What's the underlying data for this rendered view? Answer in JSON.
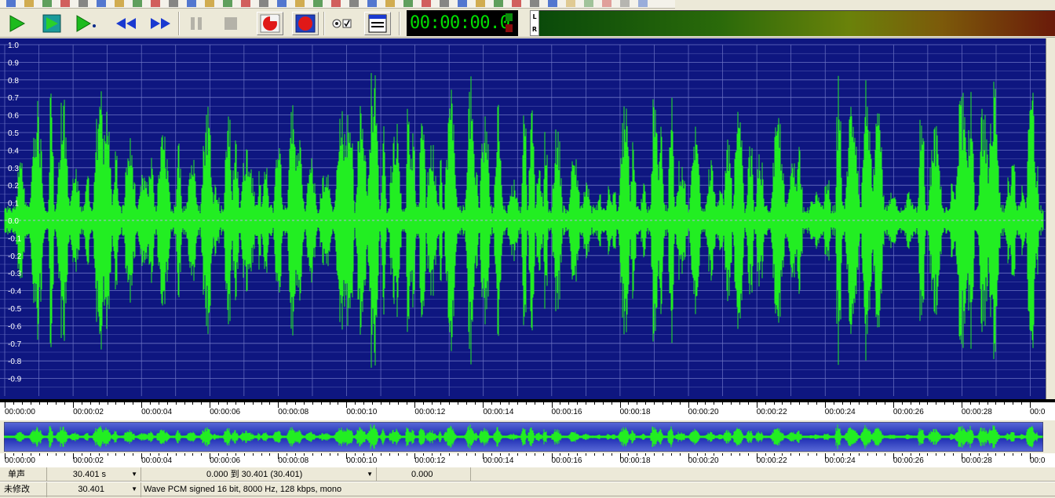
{
  "transport": {
    "buttons": [
      {
        "name": "play-button",
        "icon": "play-icon"
      },
      {
        "name": "play-selection-button",
        "icon": "play-to-end-icon"
      },
      {
        "name": "play-from-cursor-button",
        "icon": "play-cursor-icon"
      },
      {
        "name": "rewind-button",
        "icon": "rewind-icon"
      },
      {
        "name": "fast-forward-button",
        "icon": "fast-forward-icon"
      },
      {
        "name": "pause-button",
        "icon": "pause-icon"
      },
      {
        "name": "stop-button",
        "icon": "stop-icon"
      },
      {
        "name": "record-button",
        "icon": "record-icon"
      },
      {
        "name": "record-new-button",
        "icon": "record-new-icon"
      },
      {
        "name": "monitor-options-button",
        "icon": "radio-check-icon"
      },
      {
        "name": "view-window-button",
        "icon": "window-icon"
      }
    ],
    "time_display": "00:00:00.0",
    "meter_channels": [
      "L",
      "R"
    ]
  },
  "waveform": {
    "y_ticks": [
      "1.0",
      "0.9",
      "0.8",
      "0.7",
      "0.6",
      "0.5",
      "0.4",
      "0.3",
      "0.2",
      "0.1",
      "0.0",
      "-0.1",
      "-0.2",
      "-0.3",
      "-0.4",
      "-0.5",
      "-0.6",
      "-0.7",
      "-0.8",
      "-0.9"
    ],
    "duration_seconds": 30.401,
    "colors": {
      "background": "#0e1680",
      "wave": "#22ee22",
      "grid": "#6c74c4"
    }
  },
  "timeline": {
    "ticks": [
      "00:00:00",
      "00:00:02",
      "00:00:04",
      "00:00:06",
      "00:00:08",
      "00:00:10",
      "00:00:12",
      "00:00:14",
      "00:00:16",
      "00:00:18",
      "00:00:20",
      "00:00:22",
      "00:00:24",
      "00:00:26",
      "00:00:28",
      "00:0"
    ]
  },
  "overview_timeline": {
    "ticks": [
      "00:00:00",
      "00:00:02",
      "00:00:04",
      "00:00:06",
      "00:00:08",
      "00:00:10",
      "00:00:12",
      "00:00:14",
      "00:00:16",
      "00:00:18",
      "00:00:20",
      "00:00:22",
      "00:00:24",
      "00:00:26",
      "00:00:28",
      "00:0"
    ]
  },
  "status": {
    "channel_mode": "单声",
    "length": "30.401 s",
    "selection": "0.000 到 30.401 (30.401)",
    "cursor": "0.000",
    "modified": "未修改",
    "length2": "30.401",
    "format": "Wave PCM signed 16 bit, 8000 Hz, 128 kbps, mono"
  }
}
